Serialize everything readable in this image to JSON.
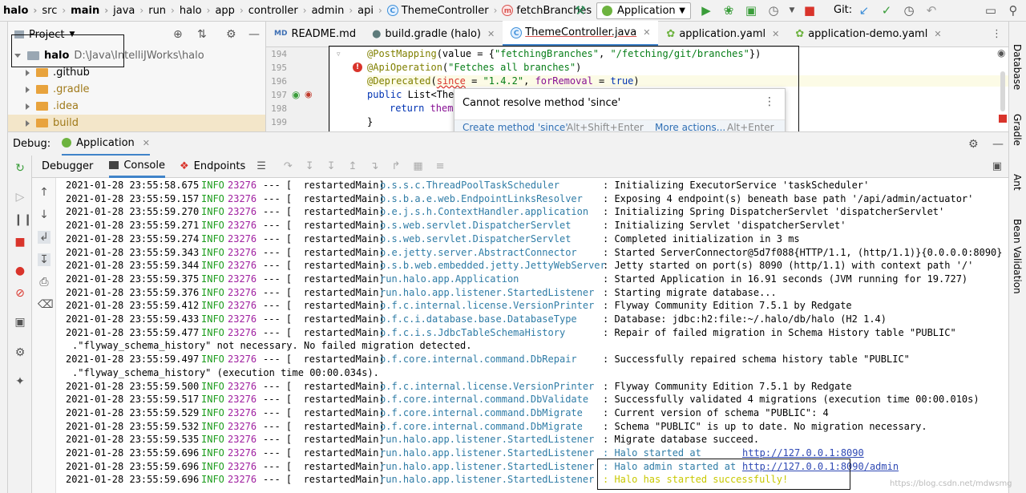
{
  "breadcrumbs": [
    {
      "label": "halo",
      "bold": true,
      "icon": ""
    },
    {
      "label": "src",
      "bold": false,
      "icon": ""
    },
    {
      "label": "main",
      "bold": true,
      "icon": ""
    },
    {
      "label": "java",
      "bold": false,
      "icon": ""
    },
    {
      "label": "run",
      "bold": false,
      "icon": ""
    },
    {
      "label": "halo",
      "bold": false,
      "icon": ""
    },
    {
      "label": "app",
      "bold": false,
      "icon": ""
    },
    {
      "label": "controller",
      "bold": false,
      "icon": ""
    },
    {
      "label": "admin",
      "bold": false,
      "icon": ""
    },
    {
      "label": "api",
      "bold": false,
      "icon": ""
    },
    {
      "label": "ThemeController",
      "bold": false,
      "icon": "class"
    },
    {
      "label": "fetchBranches",
      "bold": false,
      "icon": "method"
    }
  ],
  "toolbar": {
    "run_config": "Application",
    "git_label": "Git:"
  },
  "project": {
    "title": "Project",
    "root_name": "halo",
    "root_path": "D:\\Java\\IntelliJWorks\\halo",
    "items": [
      ".github",
      ".gradle",
      ".idea",
      "build"
    ]
  },
  "editor": {
    "tabs": [
      {
        "label": "README.md",
        "icon": "md",
        "active": false
      },
      {
        "label": "build.gradle (halo)",
        "icon": "gradle",
        "active": false
      },
      {
        "label": "ThemeController.java",
        "icon": "class",
        "active": true
      },
      {
        "label": "application.yaml",
        "icon": "yaml",
        "active": false
      },
      {
        "label": "application-demo.yaml",
        "icon": "yaml",
        "active": false
      }
    ],
    "line_numbers": [
      "194",
      "195",
      "196",
      "197",
      "198",
      "199"
    ],
    "line1": {
      "a": "@PostMapping",
      "b": "(value = {",
      "c": "\"fetchingBranches\"",
      "d": ", ",
      "e": "\"/fetching/git/branches\"",
      "f": "})"
    },
    "line2": {
      "a": "@ApiOperation",
      "b": "(",
      "c": "\"Fetches all branches\"",
      "d": ")"
    },
    "line3": {
      "a": "@Deprecated",
      "b": "(",
      "c": "since",
      "d": " = ",
      "e": "\"1.4.2\"",
      "f": ", ",
      "g": "forRemoval",
      "h": " = ",
      "i": "true",
      "j": ")"
    },
    "line4": {
      "a": "public ",
      "b": "List<Them"
    },
    "line5": {
      "a": "return ",
      "b": "theme"
    },
    "line6": {
      "a": "}"
    }
  },
  "popup": {
    "message": "Cannot resolve method 'since'",
    "action": "Create method 'since'",
    "action_shortcut": "Alt+Shift+Enter",
    "more": "More actions...",
    "more_shortcut": "Alt+Enter"
  },
  "debug": {
    "label": "Debug:",
    "config": "Application",
    "tabs": [
      "Debugger",
      "Console",
      "Endpoints"
    ]
  },
  "log": [
    {
      "ts": "2021-01-28 23:55:58.675",
      "lvl": "INFO",
      "pid": "23276",
      "thread": "--- [  restartedMain]",
      "logger": "o.s.s.c.ThreadPoolTaskScheduler",
      "msg": ": Initializing ExecutorService 'taskScheduler'",
      "style": "msg"
    },
    {
      "ts": "2021-01-28 23:55:59.157",
      "lvl": "INFO",
      "pid": "23276",
      "thread": "--- [  restartedMain]",
      "logger": "o.s.b.a.e.web.EndpointLinksResolver",
      "msg": ": Exposing 4 endpoint(s) beneath base path '/api/admin/actuator'",
      "style": "msg"
    },
    {
      "ts": "2021-01-28 23:55:59.270",
      "lvl": "INFO",
      "pid": "23276",
      "thread": "--- [  restartedMain]",
      "logger": "o.e.j.s.h.ContextHandler.application",
      "msg": ": Initializing Spring DispatcherServlet 'dispatcherServlet'",
      "style": "msg"
    },
    {
      "ts": "2021-01-28 23:55:59.271",
      "lvl": "INFO",
      "pid": "23276",
      "thread": "--- [  restartedMain]",
      "logger": "o.s.web.servlet.DispatcherServlet",
      "msg": ": Initializing Servlet 'dispatcherServlet'",
      "style": "msg"
    },
    {
      "ts": "2021-01-28 23:55:59.274",
      "lvl": "INFO",
      "pid": "23276",
      "thread": "--- [  restartedMain]",
      "logger": "o.s.web.servlet.DispatcherServlet",
      "msg": ": Completed initialization in 3 ms",
      "style": "msg"
    },
    {
      "ts": "2021-01-28 23:55:59.343",
      "lvl": "INFO",
      "pid": "23276",
      "thread": "--- [  restartedMain]",
      "logger": "o.e.jetty.server.AbstractConnector",
      "msg": ": Started ServerConnector@5d7f088{HTTP/1.1, (http/1.1)}{0.0.0.0:8090}",
      "style": "msg"
    },
    {
      "ts": "2021-01-28 23:55:59.344",
      "lvl": "INFO",
      "pid": "23276",
      "thread": "--- [  restartedMain]",
      "logger": "o.s.b.web.embedded.jetty.JettyWebServer",
      "msg": ": Jetty started on port(s) 8090 (http/1.1) with context path '/'",
      "style": "msg"
    },
    {
      "ts": "2021-01-28 23:55:59.375",
      "lvl": "INFO",
      "pid": "23276",
      "thread": "--- [  restartedMain]",
      "logger": "run.halo.app.Application",
      "msg": ": Started Application in 16.91 seconds (JVM running for 19.727)",
      "style": "msg"
    },
    {
      "ts": "2021-01-28 23:55:59.376",
      "lvl": "INFO",
      "pid": "23276",
      "thread": "--- [  restartedMain]",
      "logger": "run.halo.app.listener.StartedListener",
      "msg": ": Starting migrate database...",
      "style": "msg"
    },
    {
      "ts": "2021-01-28 23:55:59.412",
      "lvl": "INFO",
      "pid": "23276",
      "thread": "--- [  restartedMain]",
      "logger": "o.f.c.internal.license.VersionPrinter",
      "msg": ": Flyway Community Edition 7.5.1 by Redgate",
      "style": "msg"
    },
    {
      "ts": "2021-01-28 23:55:59.433",
      "lvl": "INFO",
      "pid": "23276",
      "thread": "--- [  restartedMain]",
      "logger": "o.f.c.i.database.base.DatabaseType",
      "msg": ": Database: jdbc:h2:file:~/.halo/db/halo (H2 1.4)",
      "style": "msg"
    },
    {
      "ts": "2021-01-28 23:55:59.477",
      "lvl": "INFO",
      "pid": "23276",
      "thread": "--- [  restartedMain]",
      "logger": "o.f.c.i.s.JdbcTableSchemaHistory",
      "msg": ": Repair of failed migration in Schema History table \"PUBLIC\"",
      "style": "msg"
    },
    {
      "cont": ".\"flyway_schema_history\" not necessary. No failed migration detected."
    },
    {
      "ts": "2021-01-28 23:55:59.497",
      "lvl": "INFO",
      "pid": "23276",
      "thread": "--- [  restartedMain]",
      "logger": "o.f.core.internal.command.DbRepair",
      "msg": ": Successfully repaired schema history table \"PUBLIC\"",
      "style": "msg"
    },
    {
      "cont": ".\"flyway_schema_history\" (execution time 00:00.034s)."
    },
    {
      "ts": "2021-01-28 23:55:59.500",
      "lvl": "INFO",
      "pid": "23276",
      "thread": "--- [  restartedMain]",
      "logger": "o.f.c.internal.license.VersionPrinter",
      "msg": ": Flyway Community Edition 7.5.1 by Redgate",
      "style": "msg"
    },
    {
      "ts": "2021-01-28 23:55:59.517",
      "lvl": "INFO",
      "pid": "23276",
      "thread": "--- [  restartedMain]",
      "logger": "o.f.core.internal.command.DbValidate",
      "msg": ": Successfully validated 4 migrations (execution time 00:00.010s)",
      "style": "msg"
    },
    {
      "ts": "2021-01-28 23:55:59.529",
      "lvl": "INFO",
      "pid": "23276",
      "thread": "--- [  restartedMain]",
      "logger": "o.f.core.internal.command.DbMigrate",
      "msg": ": Current version of schema \"PUBLIC\": 4",
      "style": "msg"
    },
    {
      "ts": "2021-01-28 23:55:59.532",
      "lvl": "INFO",
      "pid": "23276",
      "thread": "--- [  restartedMain]",
      "logger": "o.f.core.internal.command.DbMigrate",
      "msg": ": Schema \"PUBLIC\" is up to date. No migration necessary.",
      "style": "msg"
    },
    {
      "ts": "2021-01-28 23:55:59.535",
      "lvl": "INFO",
      "pid": "23276",
      "thread": "--- [  restartedMain]",
      "logger": "run.halo.app.listener.StartedListener",
      "msg": ": Migrate database succeed.",
      "style": "msg"
    },
    {
      "ts": "2021-01-28 23:55:59.696",
      "lvl": "INFO",
      "pid": "23276",
      "thread": "--- [  restartedMain]",
      "logger": "run.halo.app.listener.StartedListener",
      "msg": ": Halo started at",
      "link": "http://127.0.0.1:8090",
      "style": "blue"
    },
    {
      "ts": "2021-01-28 23:55:59.696",
      "lvl": "INFO",
      "pid": "23276",
      "thread": "--- [  restartedMain]",
      "logger": "run.halo.app.listener.StartedListener",
      "msg": ": Halo admin started at",
      "link": "http://127.0.0.1:8090/admin",
      "style": "blue"
    },
    {
      "ts": "2021-01-28 23:55:59.696",
      "lvl": "INFO",
      "pid": "23276",
      "thread": "--- [  restartedMain]",
      "logger": "run.halo.app.listener.StartedListener",
      "msg": ": Halo has started successfully!",
      "style": "yellow"
    }
  ],
  "right_tools": [
    "Database",
    "Gradle",
    "Ant",
    "Bean Validation"
  ],
  "watermark": "https://blog.csdn.net/mdwsmg",
  "colors": {
    "accent": "#4083c9",
    "info": "#1d9d1d",
    "pid": "#a020a0",
    "logger": "#2f7ca6",
    "link": "#2f49b4",
    "success": "#c8c800"
  }
}
